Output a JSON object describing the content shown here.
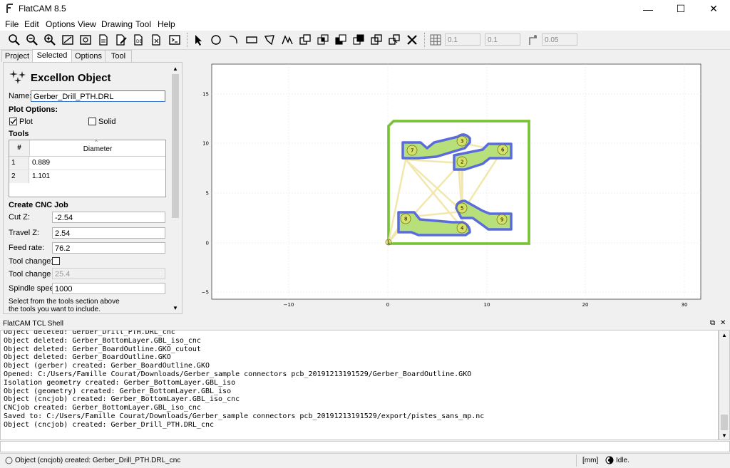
{
  "window": {
    "title": "FlatCAM 8.5"
  },
  "menu": [
    "File",
    "Edit",
    "Options",
    "View",
    "Drawing",
    "Tool",
    "Help"
  ],
  "toolbar": {
    "grid_x": "0.1",
    "grid_y": "0.1",
    "snap_max": "0.05"
  },
  "tabs": [
    "Project",
    "Selected",
    "Options",
    "Tool"
  ],
  "panel": {
    "title": "Excellon Object",
    "name_label": "Name:",
    "name_value": "Gerber_Drill_PTH.DRL",
    "plot_options": "Plot Options:",
    "plot_label": "Plot",
    "solid_label": "Solid",
    "tools_label": "Tools",
    "tools_header": [
      "#",
      "Diameter"
    ],
    "tools": [
      {
        "n": "1",
        "d": "0.889"
      },
      {
        "n": "2",
        "d": "1.101"
      }
    ],
    "cnc_title": "Create CNC Job",
    "cutz_label": "Cut Z:",
    "cutz": "-2.54",
    "travelz_label": "Travel Z:",
    "travelz": "2.54",
    "feed_label": "Feed rate:",
    "feed": "76.2",
    "toolchange_label": "Tool change:",
    "toolchangez_label": "Tool change Z:",
    "toolchangez": "25.4",
    "spindle_label": "Spindle speed:",
    "spindle": "1000",
    "hint1": "Select from the tools section above",
    "hint2": "the tools you want to include."
  },
  "plot": {
    "x_ticks": [
      "−10",
      "0",
      "10",
      "20",
      "30"
    ],
    "y_ticks": [
      "15",
      "10",
      "5",
      "0",
      "−5"
    ],
    "drill_labels": [
      "1",
      "2",
      "3",
      "4",
      "5",
      "6",
      "7",
      "8",
      "9"
    ]
  },
  "shell": {
    "title": "FlatCAM TCL Shell",
    "lines": [
      "Object deleted: Gerber_Drill_PTH.DRL_cnc",
      "Object deleted: Gerber_BottomLayer.GBL_iso_cnc",
      "Object deleted: Gerber_BoardOutline.GKO_cutout",
      "Object deleted: Gerber_BoardOutline.GKO",
      "Object (gerber) created: Gerber_BoardOutline.GKO",
      "Opened: C:/Users/Famille Courat/Downloads/Gerber_sample connectors pcb_20191213191529/Gerber_BoardOutline.GKO",
      "Isolation geometry created: Gerber_BottomLayer.GBL_iso",
      "Object (geometry) created: Gerber_BottomLayer.GBL_iso",
      "Object (cncjob) created: Gerber_BottomLayer.GBL_iso_cnc",
      "CNCjob created: Gerber_BottomLayer.GBL_iso_cnc",
      "Saved to: C:/Users/Famille Courat/Downloads/Gerber_sample connectors pcb_20191213191529/export/pistes_sans_mp.nc",
      "Object (cncjob) created: Gerber_Drill_PTH.DRL_cnc"
    ]
  },
  "status": {
    "message": "Object (cncjob) created: Gerber_Drill_PTH.DRL_cnc",
    "units": "[mm]",
    "state": "Idle."
  },
  "colors": {
    "copper_fill": "#b7e07a",
    "copper_outline": "#5a6cdc",
    "board_outline": "#8fd14f",
    "drill_path": "#f2e6a8"
  }
}
